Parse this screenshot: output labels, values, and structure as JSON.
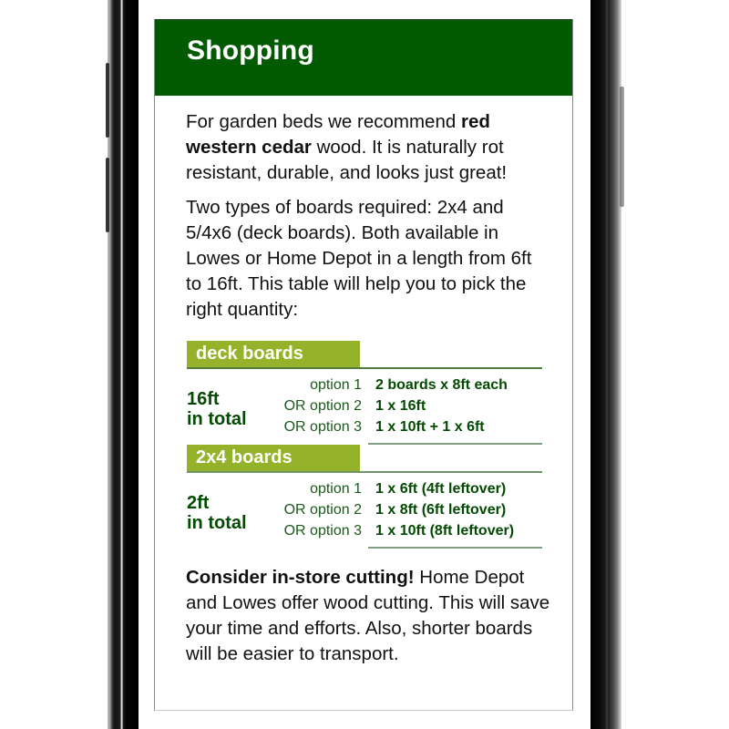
{
  "header": {
    "title": "Shopping"
  },
  "intro": {
    "p1_before": "For garden beds we recommend ",
    "p1_bold": "red western cedar",
    "p1_after": " wood. It is naturally rot resistant, durable, and looks just great!",
    "p2": "Two types of boards required: 2x4 and 5/4x6 (deck boards). Both available in Lowes or Home Depot in a length from 6ft to 16ft. This table will help you to pick the right quantity:"
  },
  "table": {
    "sections": [
      {
        "category": "deck boards",
        "total_line1": "16ft",
        "total_line2": "in total",
        "options": [
          {
            "label": "option 1",
            "value": "2 boards x 8ft each"
          },
          {
            "label": "OR option 2",
            "value": "1 x 16ft"
          },
          {
            "label": "OR option 3",
            "value": "1 x 10ft + 1 x 6ft"
          }
        ]
      },
      {
        "category": "2x4 boards",
        "total_line1": "2ft",
        "total_line2": "in total",
        "options": [
          {
            "label": "option 1",
            "value": "1 x 6ft (4ft leftover)"
          },
          {
            "label": "OR option 2",
            "value": "1 x 8ft (6ft leftover)"
          },
          {
            "label": "OR option 3",
            "value": "1 x 10ft (8ft leftover)"
          }
        ]
      }
    ]
  },
  "tip": {
    "bold": "Consider in-store cutting!",
    "text": " Home Depot and Lowes offer wood cutting. This will save your time and efforts. Also, shorter boards will be easier to transport."
  },
  "colors": {
    "header_bg": "#035a03",
    "category_bg": "#94b32a",
    "table_text": "#034a03"
  }
}
